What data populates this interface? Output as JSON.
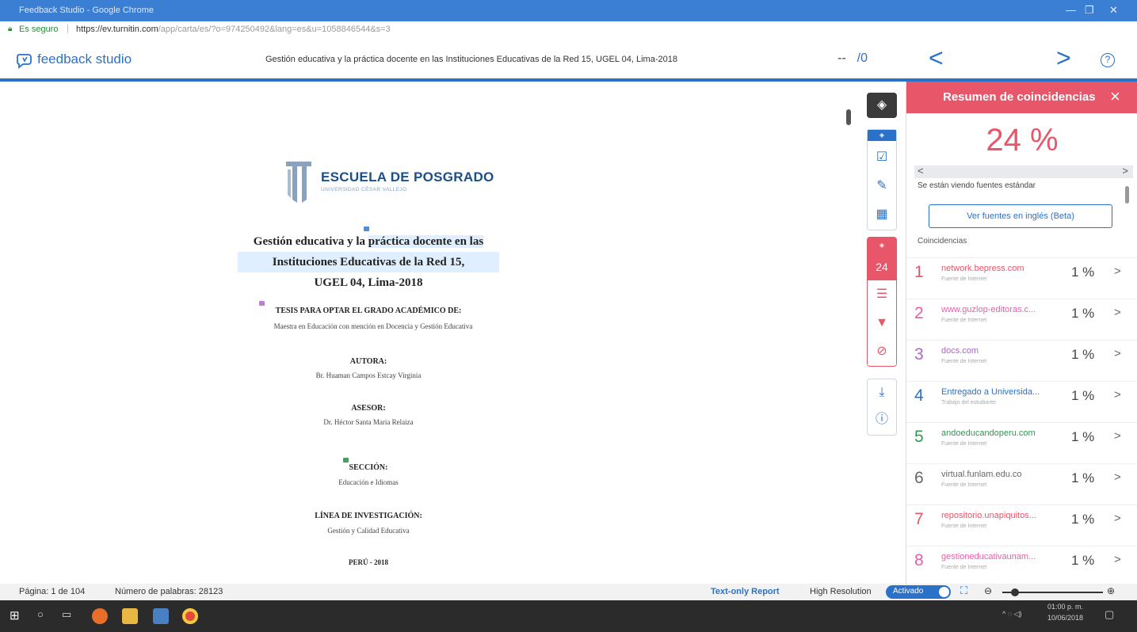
{
  "browser": {
    "window_title": "Feedback Studio - Google Chrome",
    "secure_label": "Es seguro",
    "url_main": "https://ev.turnitin.com",
    "url_rest": "/app/carta/es/?o=974250492&lang=es&u=1058846544&s=3"
  },
  "header": {
    "logo_text": "feedback studio",
    "doc_title": "Gestión educativa y la práctica docente en las Instituciones Educativas de la Red 15, UGEL 04, Lima-2018",
    "page_dash": "--",
    "page_total": "/0"
  },
  "document": {
    "school": "ESCUELA DE POSGRADO",
    "university": "UNIVERSIDAD CÉSAR VALLEJO",
    "title_line1_a": "Gestión educativa y la ",
    "title_line1_b": "práctica docente en las",
    "title_line2": "Instituciones Educativas de la Red 15,",
    "title_line3": "UGEL 04, Lima-2018",
    "tesis": "TESIS PARA OPTAR EL GRADO ACADÉMICO DE:",
    "maestra": "Maestra en Educación con mención en Docencia y Gestión Educativa",
    "autora_label": "AUTORA:",
    "autora": "Br. Huaman Campos Estcay Virginia",
    "asesor_label": "ASESOR:",
    "asesor": "Dr. Héctor Santa Maria Relaiza",
    "seccion_label": "SECCIÓN:",
    "seccion": "Educación e Idiomas",
    "linea_label": "LÍNEA DE INVESTIGACIÓN:",
    "linea": "Gestión y Calidad Educativa",
    "peru": "PERÚ - 2018"
  },
  "toolbar": {
    "similarity_count": "24"
  },
  "panel": {
    "title": "Resumen de coincidencias",
    "close": "×",
    "percentage": "24 %",
    "viewing": "Se están viendo fuentes estándar",
    "english_button": "Ver fuentes en inglés (Beta)",
    "coincidencias": "Coincidencias",
    "matches": [
      {
        "num": "1",
        "name": "network.bepress.com",
        "type": "Fuente de Internet",
        "pct": "1 %",
        "color": "#e8566a"
      },
      {
        "num": "2",
        "name": "www.guzlop-editoras.c...",
        "type": "Fuente de Internet",
        "pct": "1 %",
        "color": "#e75fa8"
      },
      {
        "num": "3",
        "name": "docs.com",
        "type": "Fuente de Internet",
        "pct": "1 %",
        "color": "#b066c7"
      },
      {
        "num": "4",
        "name": "Entregado a Universida...",
        "type": "Trabajo del estudiante",
        "pct": "1 %",
        "color": "#2a72c9"
      },
      {
        "num": "5",
        "name": "andoeducandoperu.com",
        "type": "Fuente de Internet",
        "pct": "1 %",
        "color": "#2e9a4f"
      },
      {
        "num": "6",
        "name": "virtual.funlam.edu.co",
        "type": "Fuente de Internet",
        "pct": "1 %",
        "color": "#666666"
      },
      {
        "num": "7",
        "name": "repositorio.unapiquitos...",
        "type": "Fuente de Internet",
        "pct": "1 %",
        "color": "#e8566a"
      },
      {
        "num": "8",
        "name": "gestioneducativaunam...",
        "type": "Fuente de Internet",
        "pct": "1 %",
        "color": "#e75fa8"
      }
    ]
  },
  "status": {
    "page": "Página: 1 de 104",
    "words": "Número de palabras: 28123",
    "text_only": "Text-only Report",
    "high_res": "High Resolution",
    "toggle": "Activado"
  },
  "taskbar": {
    "time": "01:00 p. m.",
    "date": "10/06/2018"
  }
}
